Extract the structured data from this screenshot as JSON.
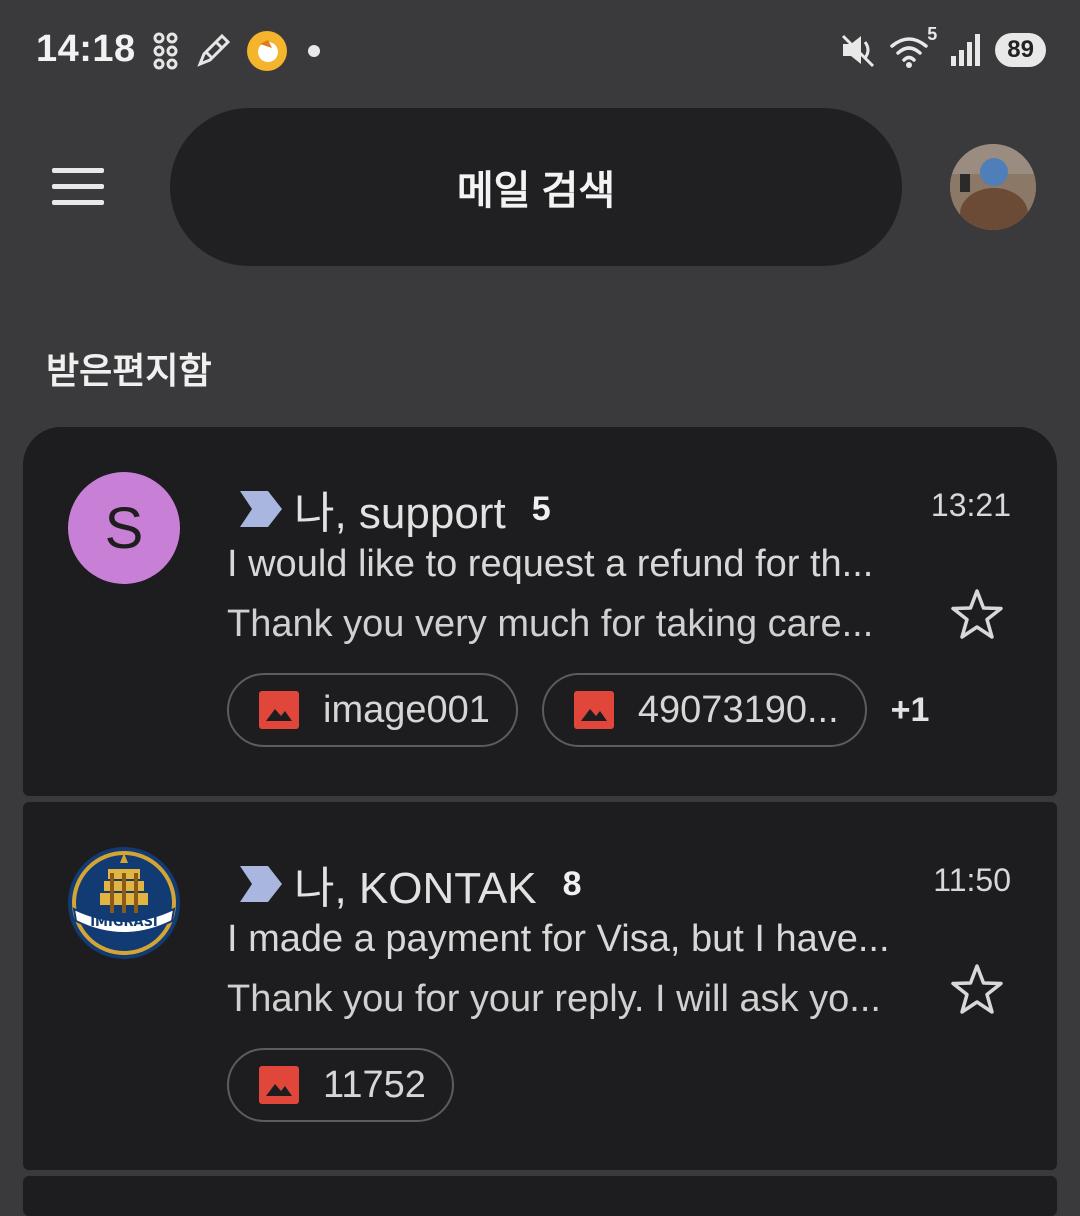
{
  "status_bar": {
    "time": "14:18",
    "battery": "89",
    "network_badge": "5",
    "icons": [
      "grid-icon",
      "pencil-icon",
      "app-badge-icon",
      "dot-icon",
      "mute-icon",
      "wifi-icon",
      "signal-icon",
      "battery-icon"
    ]
  },
  "search": {
    "placeholder": "메일 검색"
  },
  "folder": {
    "title": "받은편지함"
  },
  "emails": [
    {
      "avatar_letter": "S",
      "avatar_color": "#c87fd6",
      "sender": "나, support",
      "count": "5",
      "time": "13:21",
      "subject": "I would like to request a refund for th...",
      "snippet": "Thank you very much for taking care...",
      "attachments": [
        "image001",
        "49073190..."
      ],
      "more_attachments": "+1",
      "starred": false
    },
    {
      "avatar_logo_text": "IMIGRASI",
      "sender": "나, KONTAK",
      "count": "8",
      "time": "11:50",
      "subject": "I made a payment for Visa, but I have...",
      "snippet": "Thank you for your reply. I will ask yo...",
      "attachments": [
        "11752"
      ],
      "starred": false
    }
  ],
  "colors": {
    "background": "#3a3a3c",
    "card": "#1d1d20",
    "important_arrow": "#a8b6e0",
    "image_icon": "#e0473a"
  }
}
